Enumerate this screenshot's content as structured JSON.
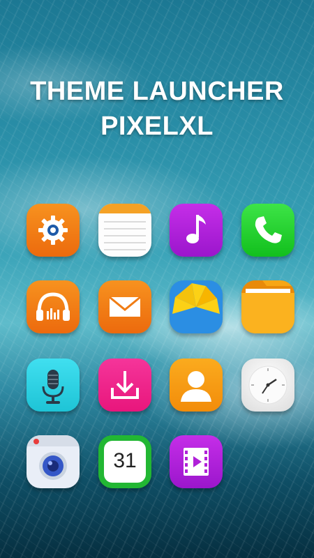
{
  "header": {
    "line1": "THEME LAUNCHER",
    "line2": "PIXELXL"
  },
  "apps": [
    {
      "icon": "settings-icon",
      "color": "#f07c14"
    },
    {
      "icon": "notes-icon",
      "color": "#f4a125"
    },
    {
      "icon": "music-icon",
      "color": "#b020d8"
    },
    {
      "icon": "phone-icon",
      "color": "#1ed12a"
    },
    {
      "icon": "headphones-icon",
      "color": "#f07c14"
    },
    {
      "icon": "mail-icon",
      "color": "#f07c14"
    },
    {
      "icon": "photos-icon",
      "color": "#2b8ee3"
    },
    {
      "icon": "folder-icon",
      "color": "#f7a615"
    },
    {
      "icon": "microphone-icon",
      "color": "#2ed3e3"
    },
    {
      "icon": "download-icon",
      "color": "#f0258a"
    },
    {
      "icon": "contacts-icon",
      "color": "#f79a12"
    },
    {
      "icon": "clock-icon",
      "color": "#eeeeee"
    },
    {
      "icon": "camera-icon",
      "color": "#e9eef7"
    },
    {
      "icon": "calendar-icon",
      "color": "#22b733"
    },
    {
      "icon": "video-icon",
      "color": "#b020d8"
    }
  ],
  "calendar": {
    "day": "31"
  }
}
